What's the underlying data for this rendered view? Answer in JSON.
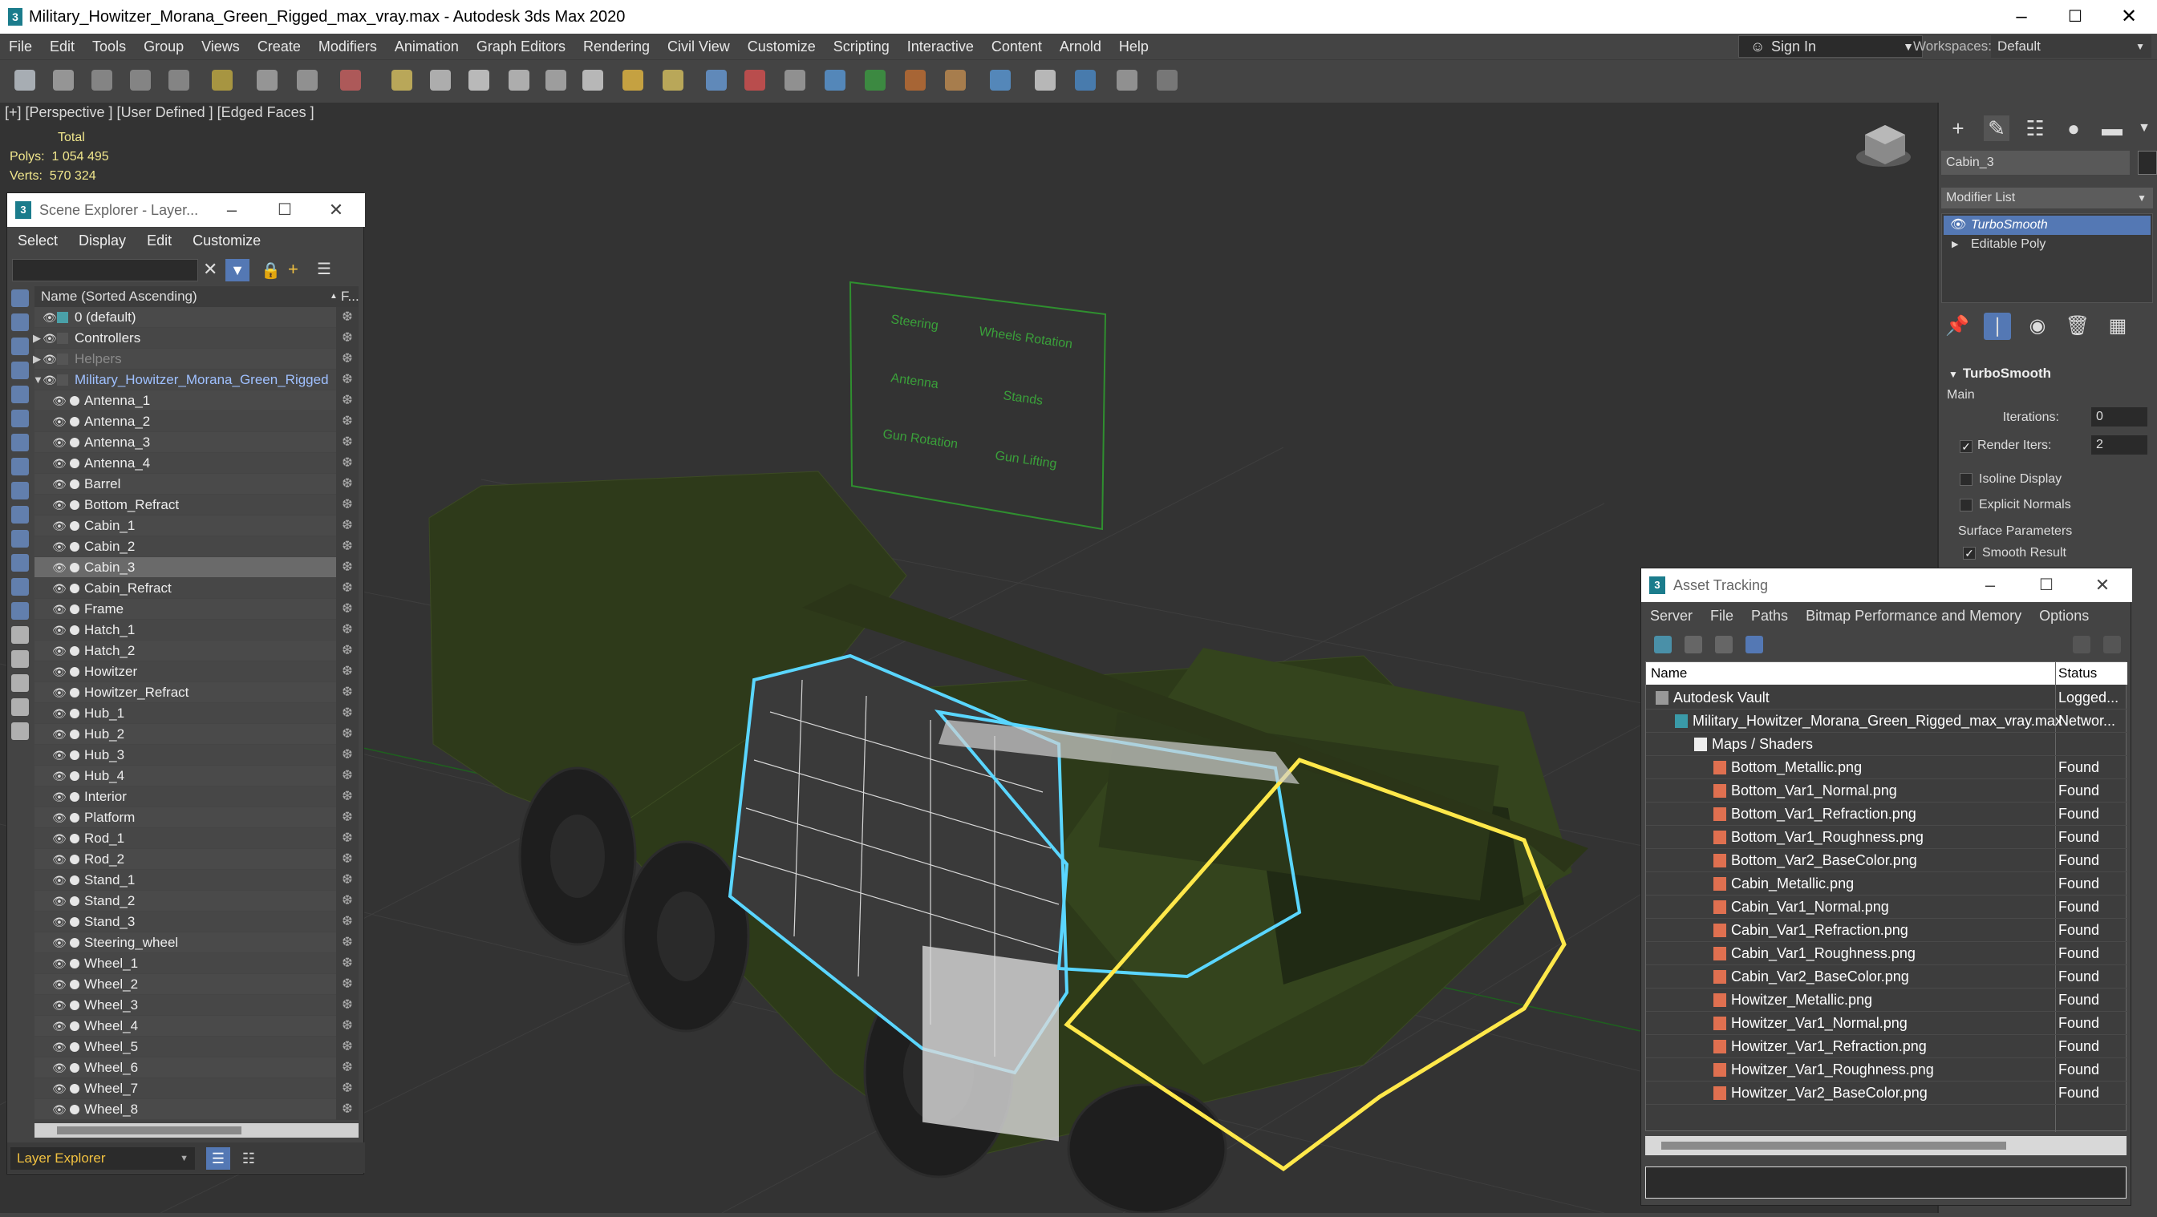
{
  "window": {
    "title": "Military_Howitzer_Morana_Green_Rigged_max_vray.max - Autodesk 3ds Max 2020"
  },
  "menubar": {
    "items": [
      "File",
      "Edit",
      "Tools",
      "Group",
      "Views",
      "Create",
      "Modifiers",
      "Animation",
      "Graph Editors",
      "Rendering",
      "Civil View",
      "Customize",
      "Scripting",
      "Interactive",
      "Content",
      "Arnold",
      "Help"
    ],
    "signin": "Sign In",
    "workspaces_label": "Workspaces:",
    "workspace_value": "Default"
  },
  "viewport": {
    "label": "[+] [Perspective ] [User Defined ] [Edged Faces ]",
    "stats_total": "Total",
    "polys_label": "Polys:",
    "polys_value": "1 054 495",
    "verts_label": "Verts:",
    "verts_value": "570 324",
    "controls": [
      "Steering",
      "Wheels Rotation",
      "Antenna",
      "Stands",
      "Gun Rotation",
      "Gun Lifting"
    ]
  },
  "command_panel": {
    "object_name": "Cabin_3",
    "modifier_list": "Modifier List",
    "stack": [
      "TurboSmooth",
      "Editable Poly"
    ],
    "rollout": "TurboSmooth",
    "main": "Main",
    "iterations_label": "Iterations:",
    "iterations_value": "0",
    "render_iters_label": "Render Iters:",
    "render_iters_value": "2",
    "isoline": "Isoline Display",
    "explicit_normals": "Explicit Normals",
    "surface_params": "Surface Parameters",
    "smooth_result": "Smooth Result"
  },
  "scene_explorer": {
    "title": "Scene Explorer - Layer...",
    "menu": [
      "Select",
      "Display",
      "Edit",
      "Customize"
    ],
    "column_name": "Name (Sorted Ascending)",
    "column_frozen": "F...",
    "layers": [
      "0 (default)",
      "Controllers",
      "Helpers",
      "Military_Howitzer_Morana_Green_Rigged"
    ],
    "objects": [
      "Antenna_1",
      "Antenna_2",
      "Antenna_3",
      "Antenna_4",
      "Barrel",
      "Bottom_Refract",
      "Cabin_1",
      "Cabin_2",
      "Cabin_3",
      "Cabin_Refract",
      "Frame",
      "Hatch_1",
      "Hatch_2",
      "Howitzer",
      "Howitzer_Refract",
      "Hub_1",
      "Hub_2",
      "Hub_3",
      "Hub_4",
      "Interior",
      "Platform",
      "Rod_1",
      "Rod_2",
      "Stand_1",
      "Stand_2",
      "Stand_3",
      "Steering_wheel",
      "Wheel_1",
      "Wheel_2",
      "Wheel_3",
      "Wheel_4",
      "Wheel_5",
      "Wheel_6",
      "Wheel_7",
      "Wheel_8"
    ],
    "selected": "Cabin_3",
    "bottom_dropdown": "Layer Explorer"
  },
  "asset_tracking": {
    "title": "Asset Tracking",
    "menu": [
      "Server",
      "File",
      "Paths",
      "Bitmap Performance and Memory",
      "Options"
    ],
    "col_name": "Name",
    "col_status": "Status",
    "rows": [
      {
        "name": "Autodesk Vault",
        "status": "Logged...",
        "indent": 0,
        "kind": "vault"
      },
      {
        "name": "Military_Howitzer_Morana_Green_Rigged_max_vray.max",
        "status": "Networ...",
        "indent": 1,
        "kind": "max"
      },
      {
        "name": "Maps / Shaders",
        "status": "",
        "indent": 2,
        "kind": "folder"
      },
      {
        "name": "Bottom_Metallic.png",
        "status": "Found",
        "indent": 3,
        "kind": "png"
      },
      {
        "name": "Bottom_Var1_Normal.png",
        "status": "Found",
        "indent": 3,
        "kind": "png"
      },
      {
        "name": "Bottom_Var1_Refraction.png",
        "status": "Found",
        "indent": 3,
        "kind": "png"
      },
      {
        "name": "Bottom_Var1_Roughness.png",
        "status": "Found",
        "indent": 3,
        "kind": "png"
      },
      {
        "name": "Bottom_Var2_BaseColor.png",
        "status": "Found",
        "indent": 3,
        "kind": "png"
      },
      {
        "name": "Cabin_Metallic.png",
        "status": "Found",
        "indent": 3,
        "kind": "png"
      },
      {
        "name": "Cabin_Var1_Normal.png",
        "status": "Found",
        "indent": 3,
        "kind": "png"
      },
      {
        "name": "Cabin_Var1_Refraction.png",
        "status": "Found",
        "indent": 3,
        "kind": "png"
      },
      {
        "name": "Cabin_Var1_Roughness.png",
        "status": "Found",
        "indent": 3,
        "kind": "png"
      },
      {
        "name": "Cabin_Var2_BaseColor.png",
        "status": "Found",
        "indent": 3,
        "kind": "png"
      },
      {
        "name": "Howitzer_Metallic.png",
        "status": "Found",
        "indent": 3,
        "kind": "png"
      },
      {
        "name": "Howitzer_Var1_Normal.png",
        "status": "Found",
        "indent": 3,
        "kind": "png"
      },
      {
        "name": "Howitzer_Var1_Refraction.png",
        "status": "Found",
        "indent": 3,
        "kind": "png"
      },
      {
        "name": "Howitzer_Var1_Roughness.png",
        "status": "Found",
        "indent": 3,
        "kind": "png"
      },
      {
        "name": "Howitzer_Var2_BaseColor.png",
        "status": "Found",
        "indent": 3,
        "kind": "png"
      }
    ]
  }
}
